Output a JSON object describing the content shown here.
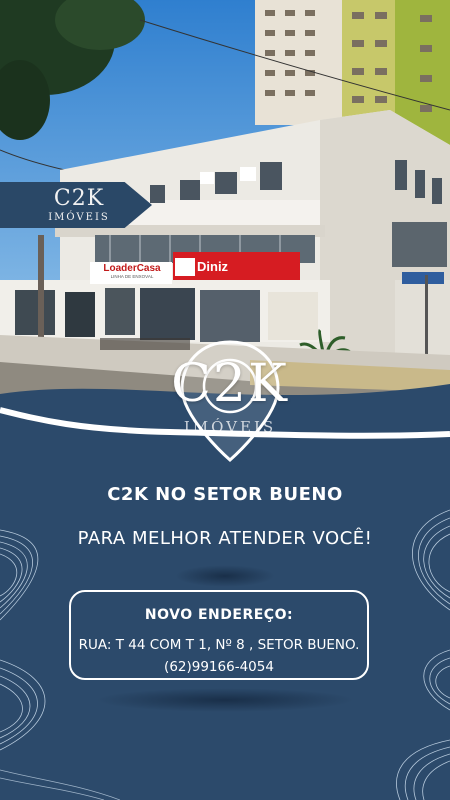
{
  "badge": {
    "logo": "C2K",
    "subtitle": "IMÓVEIS"
  },
  "storefront": {
    "sign_left": "LoaderCasa",
    "sign_left_small": "LINHA DE ENXOVAL",
    "sign_right": "Diniz"
  },
  "big_logo": {
    "text": "C2K",
    "subtitle": "IMÓVEIS"
  },
  "headline": "C2K NO SETOR BUENO",
  "subheadline": "PARA MELHOR ATENDER VOCÊ!",
  "address_card": {
    "title": "NOVO ENDEREÇO:",
    "address": "RUA:  T 44 COM T 1, Nº 8 , SETOR BUENO.",
    "phone": "(62)99166-4054"
  },
  "colors": {
    "background": "#2c4a6b",
    "badge": "#2a4867",
    "text": "#ffffff",
    "sign_red": "#d61c22"
  },
  "icons": [
    "location-pin-icon",
    "wave-line-decoration"
  ]
}
